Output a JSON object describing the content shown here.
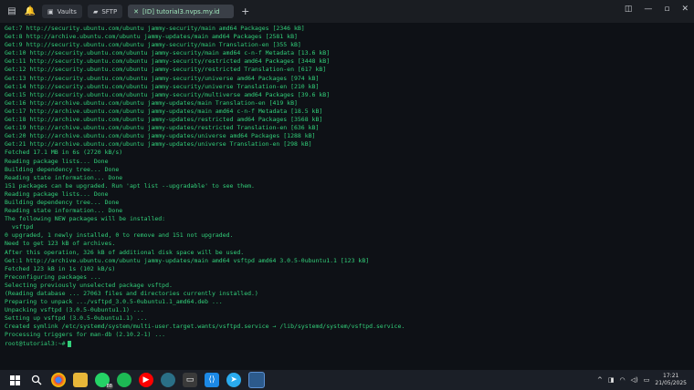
{
  "tabs": [
    {
      "label": "Vaults"
    },
    {
      "label": "SFTP"
    },
    {
      "label": "[ID] tutorial3.nvps.my.id",
      "active": true
    }
  ],
  "terminal": {
    "lines": [
      "Get:7 http://security.ubuntu.com/ubuntu jammy-security/main amd64 Packages [2346 kB]",
      "Get:8 http://archive.ubuntu.com/ubuntu jammy-updates/main amd64 Packages [2581 kB]",
      "Get:9 http://security.ubuntu.com/ubuntu jammy-security/main Translation-en [355 kB]",
      "Get:10 http://security.ubuntu.com/ubuntu jammy-security/main amd64 c-n-f Metadata [13.6 kB]",
      "Get:11 http://security.ubuntu.com/ubuntu jammy-security/restricted amd64 Packages [3448 kB]",
      "Get:12 http://security.ubuntu.com/ubuntu jammy-security/restricted Translation-en [617 kB]",
      "Get:13 http://security.ubuntu.com/ubuntu jammy-security/universe amd64 Packages [974 kB]",
      "Get:14 http://security.ubuntu.com/ubuntu jammy-security/universe Translation-en [210 kB]",
      "Get:15 http://security.ubuntu.com/ubuntu jammy-security/multiverse amd64 Packages [39.6 kB]",
      "Get:16 http://archive.ubuntu.com/ubuntu jammy-updates/main Translation-en [419 kB]",
      "Get:17 http://archive.ubuntu.com/ubuntu jammy-updates/main amd64 c-n-f Metadata [18.5 kB]",
      "Get:18 http://archive.ubuntu.com/ubuntu jammy-updates/restricted amd64 Packages [3568 kB]",
      "Get:19 http://archive.ubuntu.com/ubuntu jammy-updates/restricted Translation-en [636 kB]",
      "Get:20 http://archive.ubuntu.com/ubuntu jammy-updates/universe amd64 Packages [1288 kB]",
      "Get:21 http://archive.ubuntu.com/ubuntu jammy-updates/universe Translation-en [298 kB]",
      "Fetched 17.1 MB in 6s (2720 kB/s)",
      "Reading package lists... Done",
      "Building dependency tree... Done",
      "Reading state information... Done",
      "151 packages can be upgraded. Run 'apt list --upgradable' to see them.",
      "Reading package lists... Done",
      "Building dependency tree... Done",
      "Reading state information... Done",
      "The following NEW packages will be installed:",
      "  vsftpd",
      "0 upgraded, 1 newly installed, 0 to remove and 151 not upgraded.",
      "Need to get 123 kB of archives.",
      "After this operation, 326 kB of additional disk space will be used.",
      "Get:1 http://archive.ubuntu.com/ubuntu jammy-updates/main amd64 vsftpd amd64 3.0.5-0ubuntu1.1 [123 kB]",
      "Fetched 123 kB in 1s (102 kB/s)",
      "Preconfiguring packages ...",
      "Selecting previously unselected package vsftpd.",
      "(Reading database ... 27063 files and directories currently installed.)",
      "Preparing to unpack .../vsftpd_3.0.5-0ubuntu1.1_amd64.deb ...",
      "Unpacking vsftpd (3.0.5-0ubuntu1.1) ...",
      "Setting up vsftpd (3.0.5-0ubuntu1.1) ...",
      "Created symlink /etc/systemd/system/multi-user.target.wants/vsftpd.service → /lib/systemd/system/vsftpd.service.",
      "Processing triggers for man-db (2.10.2-1) ..."
    ],
    "prompt": "root@tutorial3:~#"
  },
  "taskbar": {
    "time": "17:21",
    "date": "21/05/2025",
    "whatsapp_badge": "88"
  }
}
